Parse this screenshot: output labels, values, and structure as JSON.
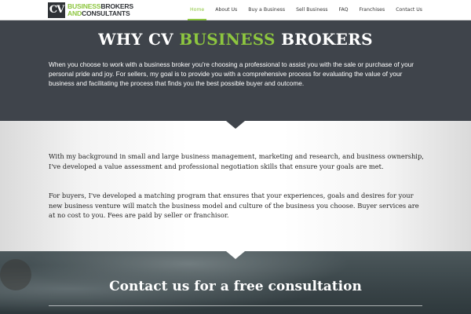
{
  "header": {
    "logo": {
      "mark": "CV",
      "line1_green": "BUSINESS",
      "line1_dark": "BROKERS",
      "line2_green": "AND",
      "line2_dark": "CONSULTANTS"
    },
    "nav": [
      {
        "label": "Home",
        "active": true
      },
      {
        "label": "About Us",
        "active": false
      },
      {
        "label": "Buy a Business",
        "active": false
      },
      {
        "label": "Sell Business",
        "active": false
      },
      {
        "label": "FAQ",
        "active": false
      },
      {
        "label": "Franchises",
        "active": false
      },
      {
        "label": "Contact Us",
        "active": false
      }
    ]
  },
  "why": {
    "title_pre": "WHY CV",
    "title_green": "BUSINESS",
    "title_post": "BROKERS",
    "text": "When you choose to work with a business broker you're choosing a professional to assist you with the sale or purchase of your personal pride and joy. For sellers, my goal is to provide you with a comprehensive process for evaluating the value of your business and facilitating the process that finds you the best possible buyer and outcome."
  },
  "about": {
    "p1": "With my background in small and large business management, marketing and research, and business ownership, I've developed  a value assessment and professional negotiation skills that ensure  your goals are met.",
    "p2": "For buyers, I've developed a matching program that ensures that your experiences, goals and desires for your new business venture will match the business model and culture of the business you choose.  Buyer services are at no cost to you.  Fees are paid by seller or franchisor."
  },
  "contact": {
    "title": "Contact us for a free consultation"
  },
  "colors": {
    "accent": "#8dc63f",
    "dark_section": "#3f444b"
  }
}
